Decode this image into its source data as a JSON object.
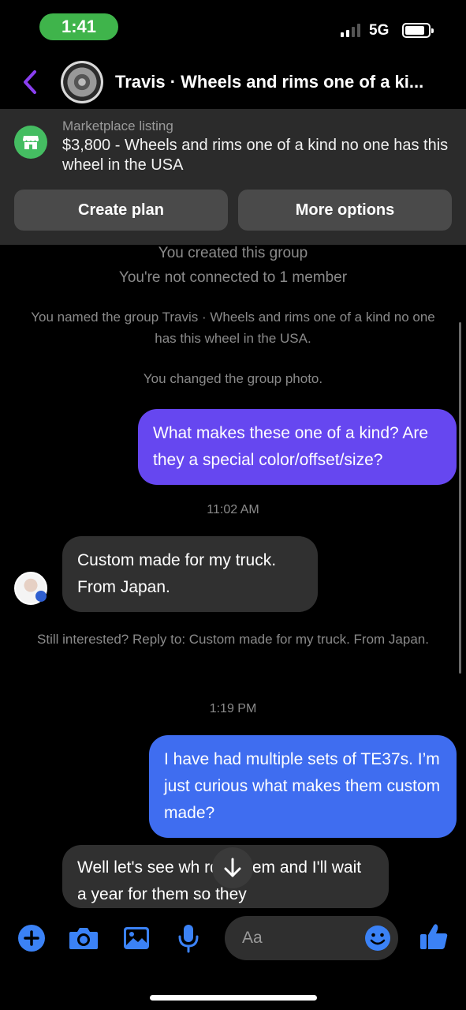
{
  "status_bar": {
    "time": "1:41",
    "network": "5G"
  },
  "header": {
    "title": "Travis · Wheels and rims one of a ki..."
  },
  "listing": {
    "kicker": "Marketplace listing",
    "title": "$3,800 - Wheels and rims one of a kind no one has this wheel in the USA",
    "create_plan_label": "Create plan",
    "more_options_label": "More options"
  },
  "conversation": {
    "created": "You created this group",
    "not_connected": "You're not connected to 1 member",
    "named_group": "You named the group Travis · Wheels and rims one of a kind no one has this wheel in the USA.",
    "changed_photo": "You changed the group photo.",
    "msg_out_1": "What makes these one of a kind? Are they a special color/offset/size?",
    "time_1": "11:02 AM",
    "msg_in_1": "Custom made for my truck. From Japan.",
    "still_interested": "Still interested? Reply to: Custom made for my truck. From Japan.",
    "time_2": "1:19 PM",
    "msg_out_2": "I have had multiple sets of TE37s. I’m just curious what makes them custom made?",
    "msg_in_2": "Well let's see wh    rder them and I'll wait a year for them so they"
  },
  "composer": {
    "placeholder": "Aa"
  },
  "colors": {
    "outgoing_purple": "#6647f0",
    "outgoing_blue": "#3f6df0",
    "incoming_gray": "#303030",
    "accent_blue": "#3b82f6",
    "status_green": "#3fb44b",
    "back_purple": "#8a3ff0"
  }
}
